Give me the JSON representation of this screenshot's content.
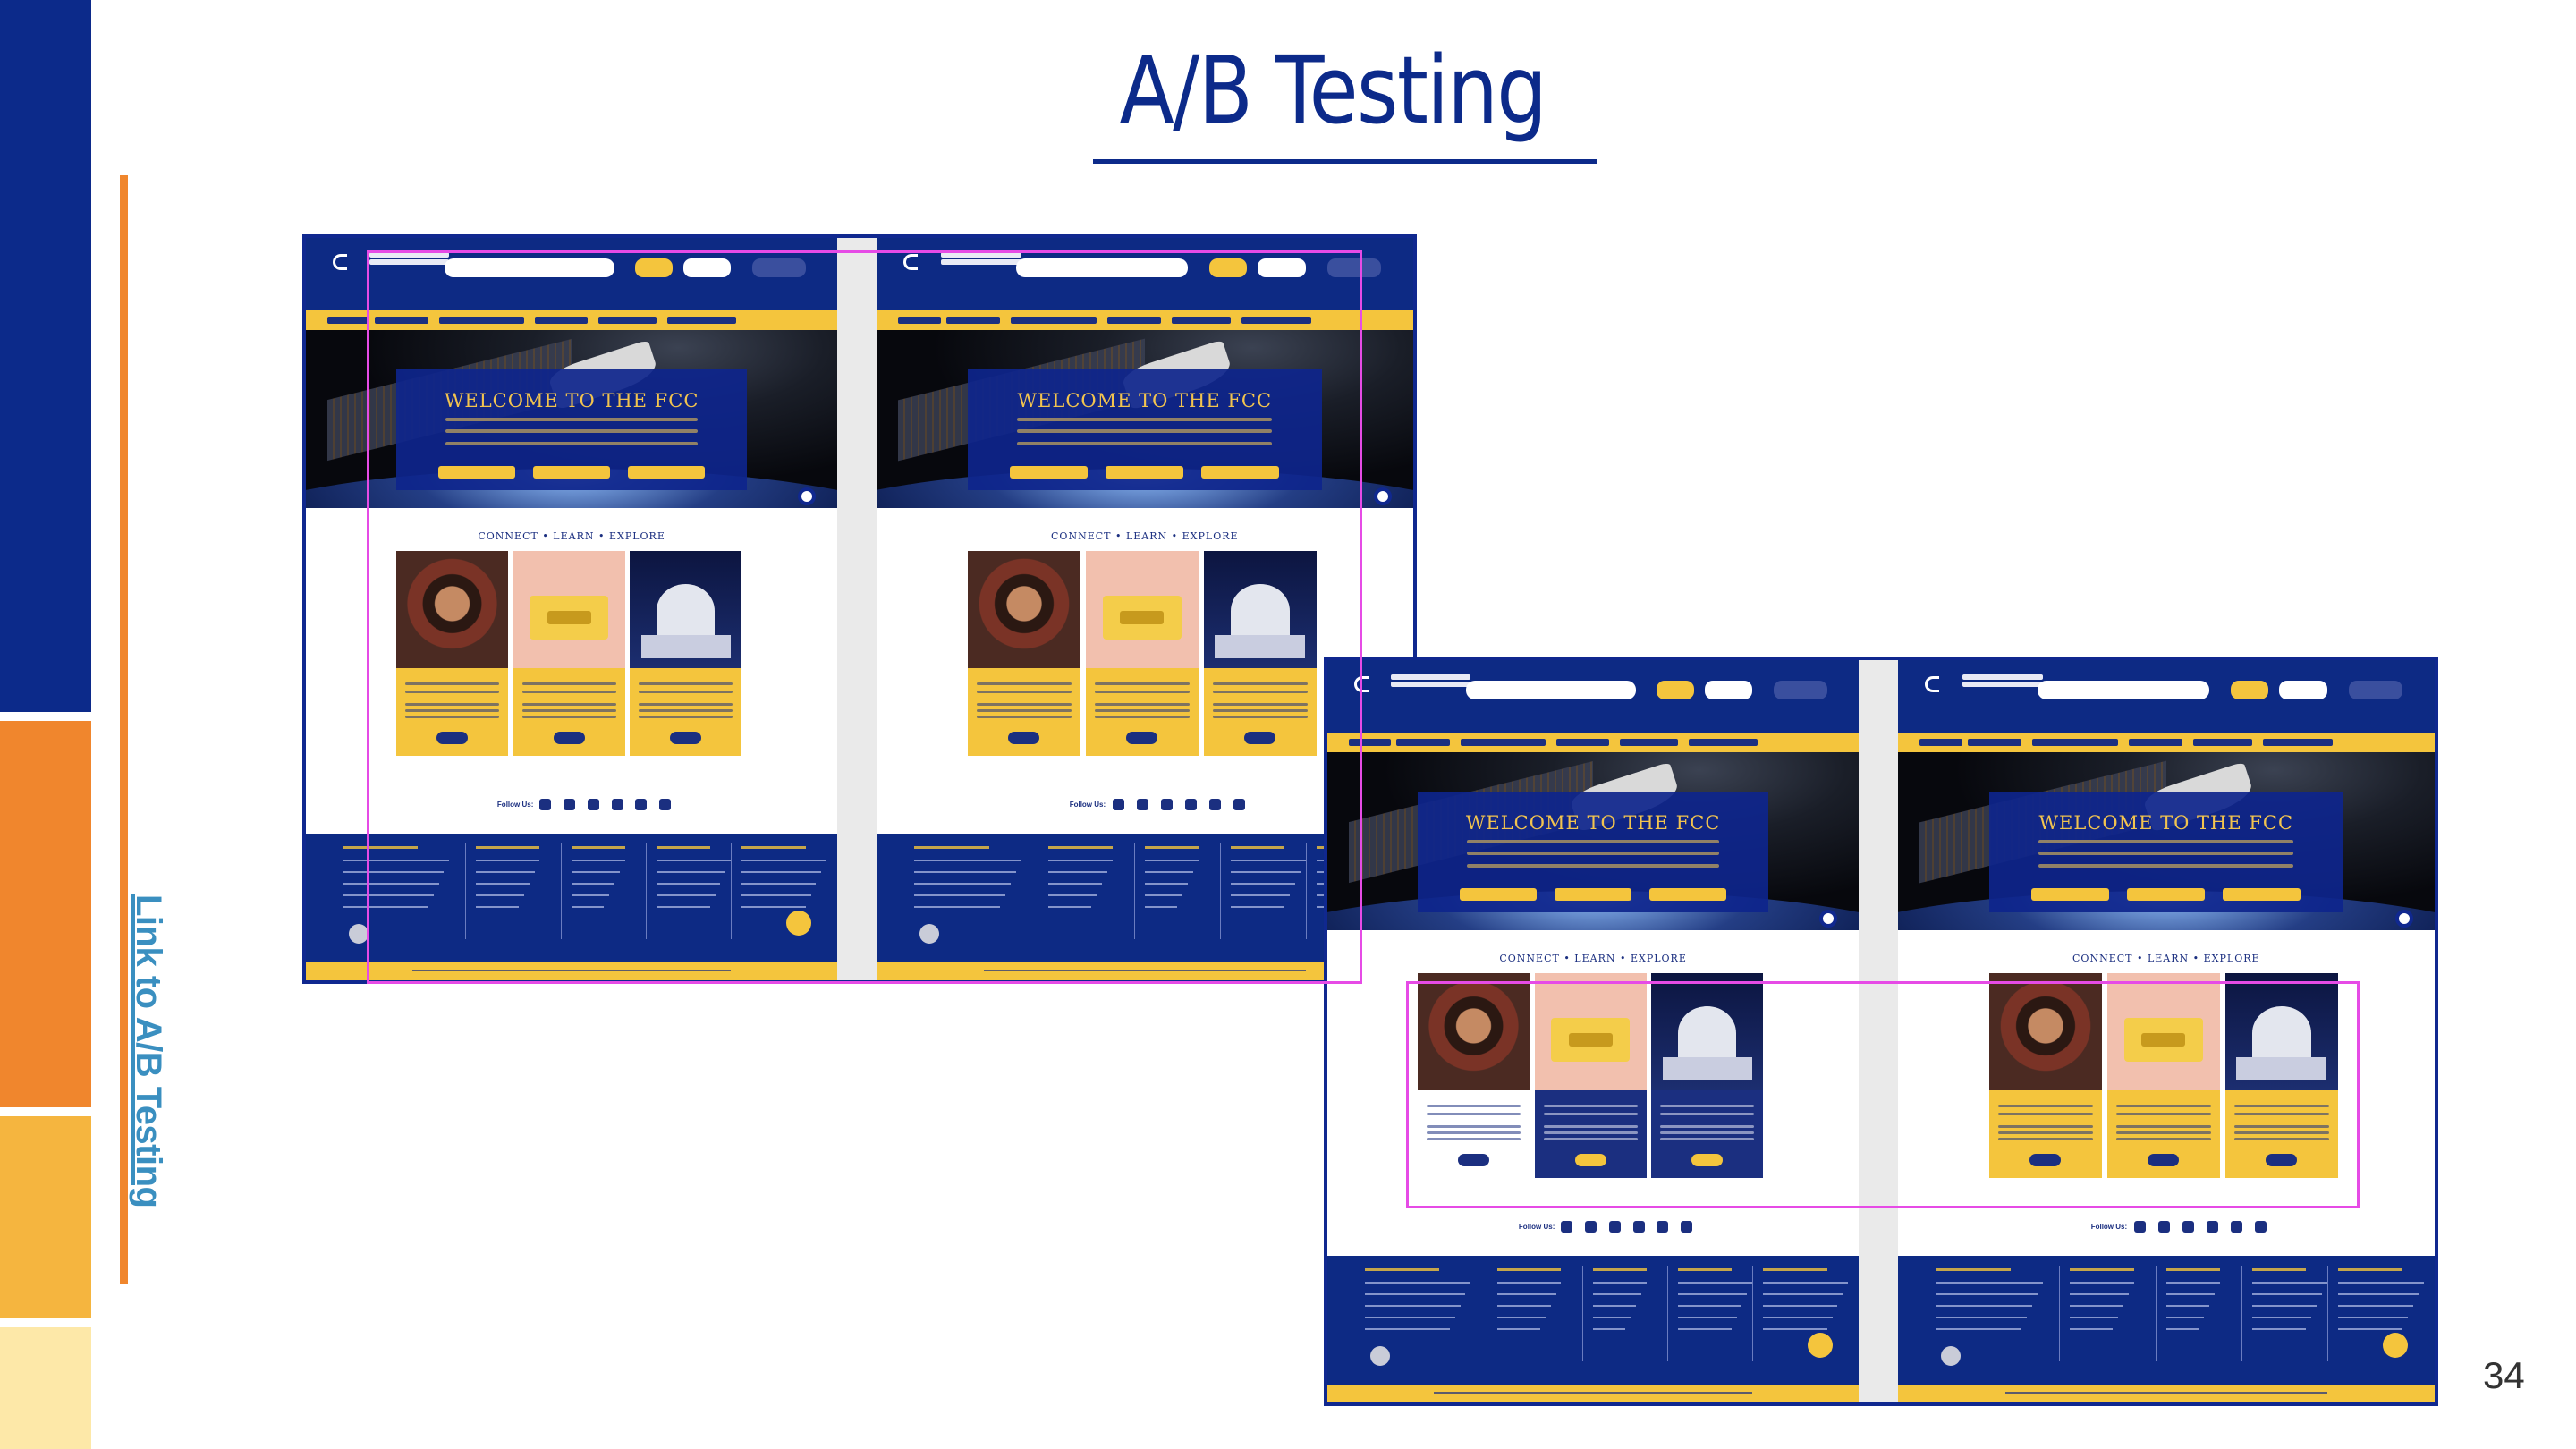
{
  "slide": {
    "title": "A/B Testing",
    "link_text": "Link to A/B Testing",
    "page_number": "34"
  },
  "colors": {
    "navy": "#10288f",
    "orange": "#f0862d",
    "gold": "#f4c53d",
    "pale_yellow": "#fde8a8",
    "highlight_magenta": "#e64be6"
  },
  "side_bars": [
    "#0c2a8a",
    "#f0862d",
    "#f5b53f",
    "#fde8a8"
  ],
  "screenshots": [
    {
      "name": "variant-a-b-header-test",
      "note_highlight": "header-and-hero",
      "panels": [
        "variant-a",
        "variant-b"
      ]
    },
    {
      "name": "variant-a-b-cards-test",
      "note_highlight": "feature-cards",
      "panels": [
        "variant-a",
        "variant-b"
      ]
    }
  ]
}
